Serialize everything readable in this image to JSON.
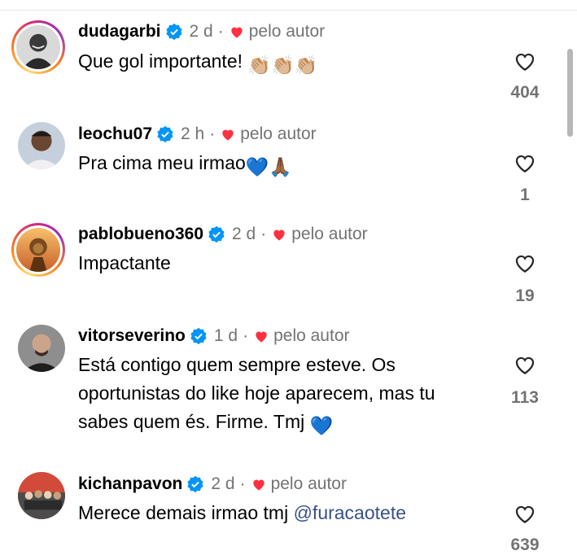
{
  "comments": [
    {
      "username": "dudagarbi",
      "time": "2 d",
      "separator": "·",
      "by_author": "pelo autor",
      "text": "Que gol importante!",
      "emojis": "👏🏼👏🏼👏🏼",
      "likes": "404",
      "avatar": "bw-man-smiling",
      "story_ring": true
    },
    {
      "username": "leochu07",
      "time": "2 h",
      "separator": "·",
      "by_author": "pelo autor",
      "text": "Pra cima meu irmao",
      "emojis": "💙🙏🏾",
      "likes": "1",
      "avatar": "man-portrait",
      "story_ring": false
    },
    {
      "username": "pablobueno360",
      "time": "2 d",
      "separator": "·",
      "by_author": "pelo autor",
      "text": "Impactante",
      "likes": "19",
      "avatar": "lion-sunset",
      "story_ring": true
    },
    {
      "username": "vitorseverino",
      "time": "1 d",
      "separator": "·",
      "by_author": "pelo autor",
      "text_lines": [
        "Está contigo quem sempre esteve. Os",
        "oportunistas do like hoje aparecem, mas tu",
        "sabes quem és. Firme. Tmj"
      ],
      "emojis": "💙",
      "likes": "113",
      "avatar": "bald-man",
      "story_ring": false
    },
    {
      "username": "kichanpavon",
      "time": "2 d",
      "separator": "·",
      "by_author": "pelo autor",
      "text": "Merece demais irmao tmj",
      "mention": "@furacaotete",
      "likes": "639",
      "avatar": "group-photo",
      "story_ring": false
    }
  ],
  "icons": {
    "verified": "verified-badge-icon",
    "author_heart": "red-heart-icon",
    "like": "heart-outline-icon"
  },
  "colors": {
    "verified": "#0095f6",
    "author_heart": "#ff3040",
    "secondary_text": "#737373",
    "mention": "#385185"
  }
}
